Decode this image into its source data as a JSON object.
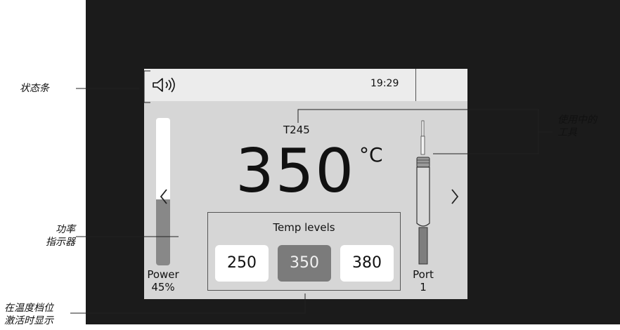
{
  "annotations": {
    "status_bar": "状态条",
    "tool_in_use_line1": "使用中的",
    "tool_in_use_line2": "工具",
    "power_indicator_line1": "功率",
    "power_indicator_line2": "指示器",
    "temp_levels_note_line1": "在温度档位",
    "temp_levels_note_line2": "激活时显示"
  },
  "status": {
    "time": "19:29",
    "sound_icon": "speaker-volume-icon"
  },
  "main": {
    "tool": "T245",
    "temperature": "350",
    "unit": "°C",
    "power_title": "Power",
    "power_value": "45%",
    "power_level": 0.45,
    "port_title": "Port",
    "port_value": "1",
    "prev_icon": "chevron-left-icon",
    "next_icon": "chevron-right-icon"
  },
  "temp_levels": {
    "title": "Temp levels",
    "levels": [
      "250",
      "350",
      "380"
    ],
    "active_index": 1
  },
  "colors": {
    "bezel": "#1b1b1b",
    "screen": "#d6d6d6",
    "status_bar": "#ececec",
    "active_level": "#7b7b7b"
  }
}
